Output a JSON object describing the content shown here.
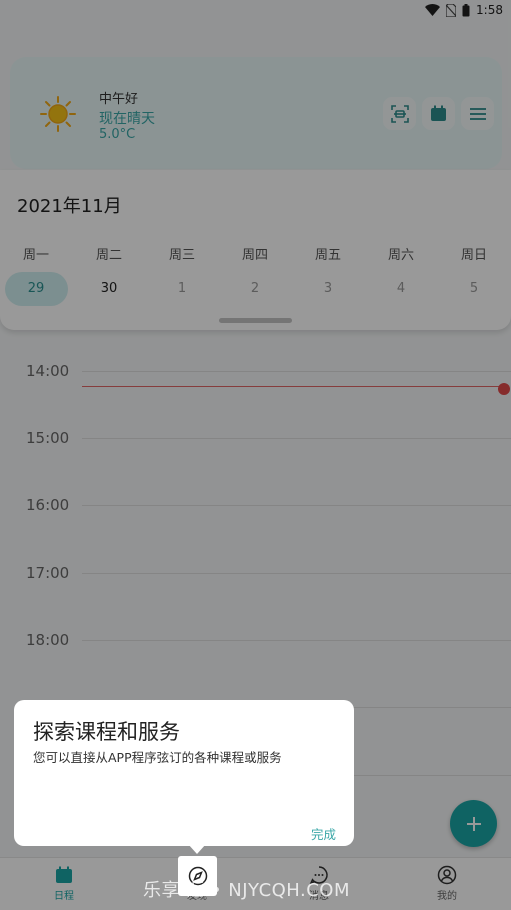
{
  "status": {
    "time": "1:58"
  },
  "weather": {
    "greeting": "中午好",
    "description": "现在晴天",
    "temperature": "5.0°C"
  },
  "calendar": {
    "month": "2021年11月",
    "weekdays": [
      "周一",
      "周二",
      "周三",
      "周四",
      "周五",
      "周六",
      "周日"
    ],
    "dates": [
      "29",
      "30",
      "1",
      "2",
      "3",
      "4",
      "5"
    ]
  },
  "timeline": {
    "hours": [
      "14:00",
      "15:00",
      "16:00",
      "17:00",
      "18:00"
    ]
  },
  "tooltip": {
    "title": "探索课程和服务",
    "body": "您可以直接从APP程序弦订的各种课程或服务",
    "done": "完成"
  },
  "nav": {
    "items": [
      {
        "label": "日程"
      },
      {
        "label": "发现"
      },
      {
        "label": "消息"
      },
      {
        "label": "我的"
      }
    ]
  },
  "watermark": "乐享  汇 • NJYCQH.COM",
  "colors": {
    "accent": "#1aa6a6",
    "now_line": "#e04a4a"
  }
}
